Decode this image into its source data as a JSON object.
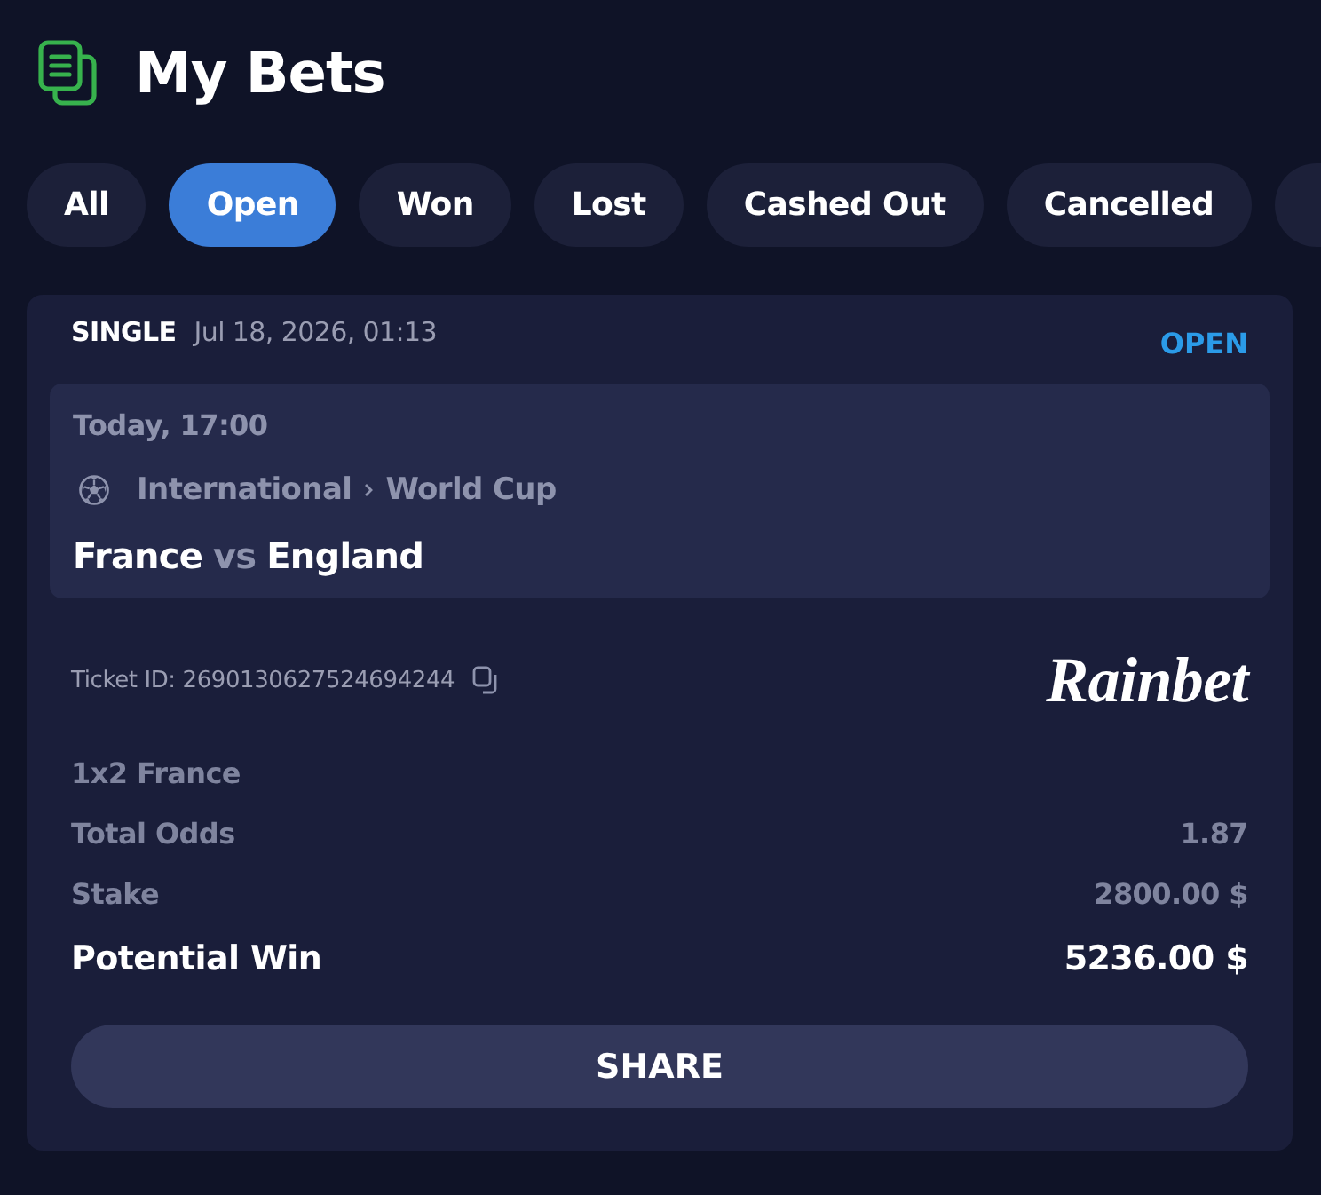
{
  "header": {
    "title": "My Bets"
  },
  "tabs": [
    {
      "label": "All",
      "selected": false
    },
    {
      "label": "Open",
      "selected": true
    },
    {
      "label": "Won",
      "selected": false
    },
    {
      "label": "Lost",
      "selected": false
    },
    {
      "label": "Cashed Out",
      "selected": false
    },
    {
      "label": "Cancelled",
      "selected": false
    },
    {
      "selected": false
    }
  ],
  "bet": {
    "type": "SINGLE",
    "placed_at": "Jul 18, 2026, 01:13",
    "status": "OPEN",
    "event": {
      "start": "Today, 17:00",
      "category": "International",
      "league": "World Cup",
      "home": "France",
      "separator": "vs",
      "away": "England"
    },
    "ticket_id": "Ticket ID: 2690130627524694244",
    "brand": "Rainbet",
    "selection": "1x2 France",
    "lines": [
      {
        "label": "Total Odds",
        "value": "1.87",
        "kind": "detail"
      },
      {
        "label": "Stake",
        "value": "2800.00 $",
        "kind": "detail"
      },
      {
        "label": "Potential Win",
        "value": "5236.00 $",
        "kind": "total"
      }
    ],
    "share_button": "SHARE"
  }
}
